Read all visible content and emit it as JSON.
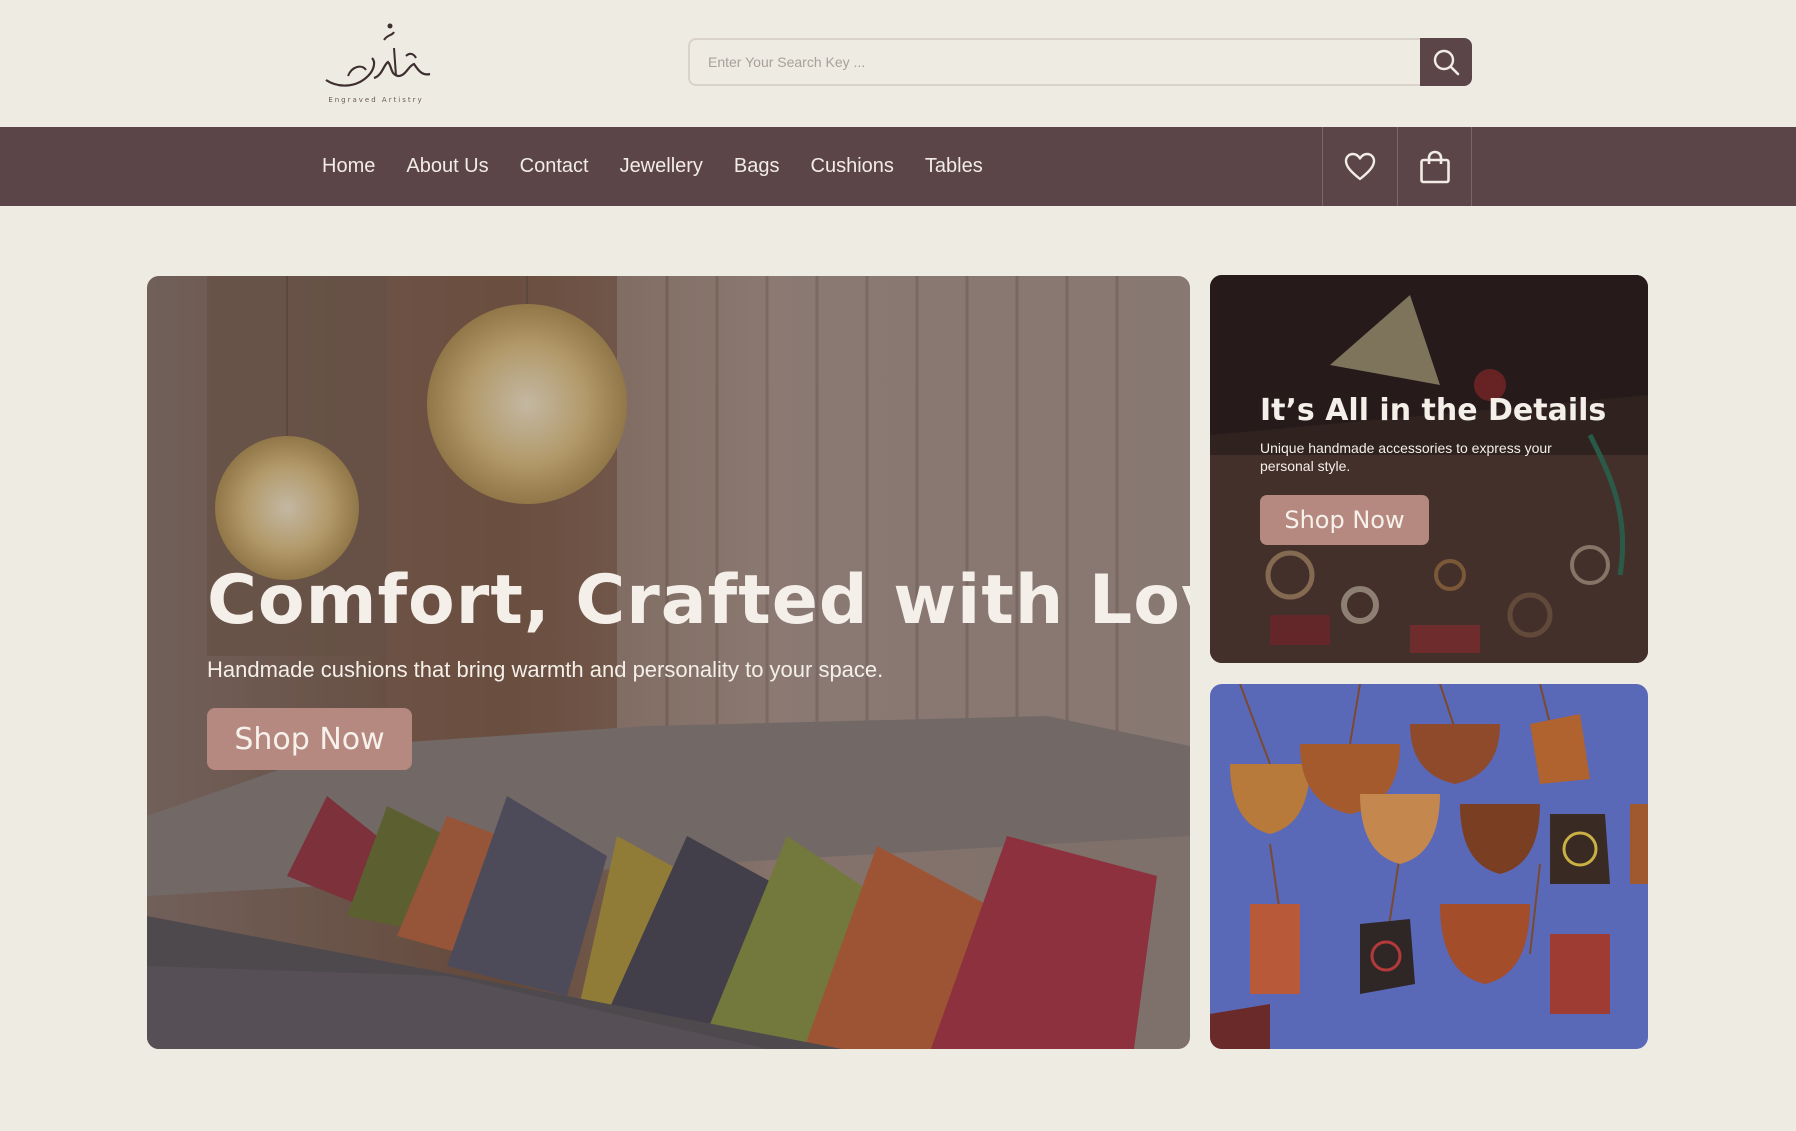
{
  "header": {
    "logo_alt": "Engraved Artistry",
    "search": {
      "placeholder": "Enter Your Search Key ..."
    }
  },
  "nav": {
    "links": [
      "Home",
      "About Us",
      "Contact",
      "Jewellery",
      "Bags",
      "Cushions",
      "Tables"
    ],
    "icons": [
      "heart-icon",
      "shopping-bag-icon"
    ]
  },
  "hero": {
    "title": "Comfort, Crafted with Love",
    "subtitle": "Handmade cushions that bring warmth and personality to your space.",
    "button": "Shop Now"
  },
  "card_jewellery": {
    "title": "It’s All in the Details",
    "subtitle": "Unique handmade accessories to express your personal style.",
    "button": "Shop Now"
  },
  "colors": {
    "background": "#eeebe3",
    "nav": "#5c4548",
    "button": "#b5897f",
    "text_light": "#f4efe9"
  }
}
